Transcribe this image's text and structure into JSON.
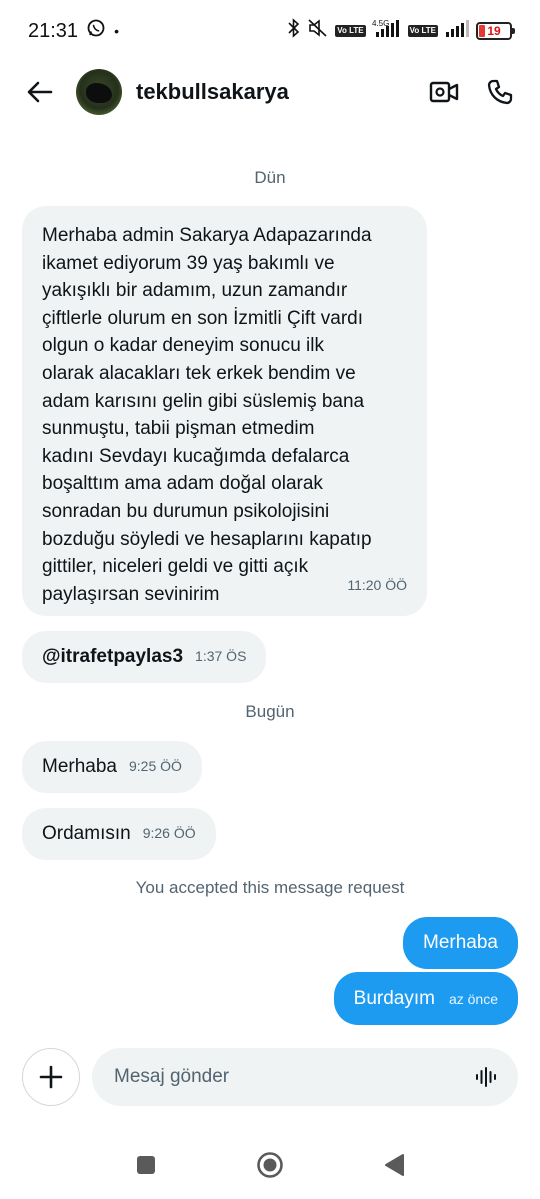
{
  "status_bar": {
    "time": "21:31",
    "network": "4.5G",
    "volte_label": "Vo LTE",
    "battery": "19",
    "icons": [
      "whatsapp-icon",
      "bluetooth-icon",
      "mute-icon",
      "signal-icon",
      "battery-icon"
    ]
  },
  "header": {
    "username": "tekbullsakarya",
    "icons": [
      "back-arrow-icon",
      "video-call-icon",
      "phone-icon"
    ]
  },
  "conversation": {
    "date_yesterday": "Dün",
    "long_message": {
      "text": "Merhaba admin Sakarya Adapazarında\nikamet ediyorum 39 yaş  bakımlı ve\nyakışıklı bir adamım, uzun zamandır\nçiftlerle olurum en son İzmitli  Çift vardı\nolgun o kadar deneyim sonucu ilk\nolarak alacakları tek erkek bendim ve\nadam karısını gelin gibi süslemiş bana\nsunmuştu, tabii pişman etmedim\nkadını Sevdayı kucağımda defalarca\nboşalttım ama adam doğal olarak\nsonradan bu durumun psikolojisini\nbozduğu söyledi ve hesaplarını kapatıp\ngittiler, niceleri geldi ve gitti açık\npaylaşırsan sevinirim",
      "time": "11:20 ÖÖ"
    },
    "mention_message": {
      "text": "@itrafetpaylas3",
      "time": "1:37 ÖS"
    },
    "date_today": "Bugün",
    "incoming": [
      {
        "text": "Merhaba",
        "time": "9:25 ÖÖ"
      },
      {
        "text": "Ordamısın",
        "time": "9:26 ÖÖ"
      }
    ],
    "accepted_note": "You accepted this message request",
    "outgoing": [
      {
        "text": "Merhaba",
        "time": ""
      },
      {
        "text": "Burdayım",
        "time": "az önce"
      }
    ]
  },
  "composer": {
    "placeholder": "Mesaj gönder",
    "icons": [
      "plus-icon",
      "voice-icon"
    ]
  },
  "colors": {
    "accent": "#1d9bf0",
    "incoming_bubble": "#eff3f4",
    "secondary_text": "#536471"
  }
}
